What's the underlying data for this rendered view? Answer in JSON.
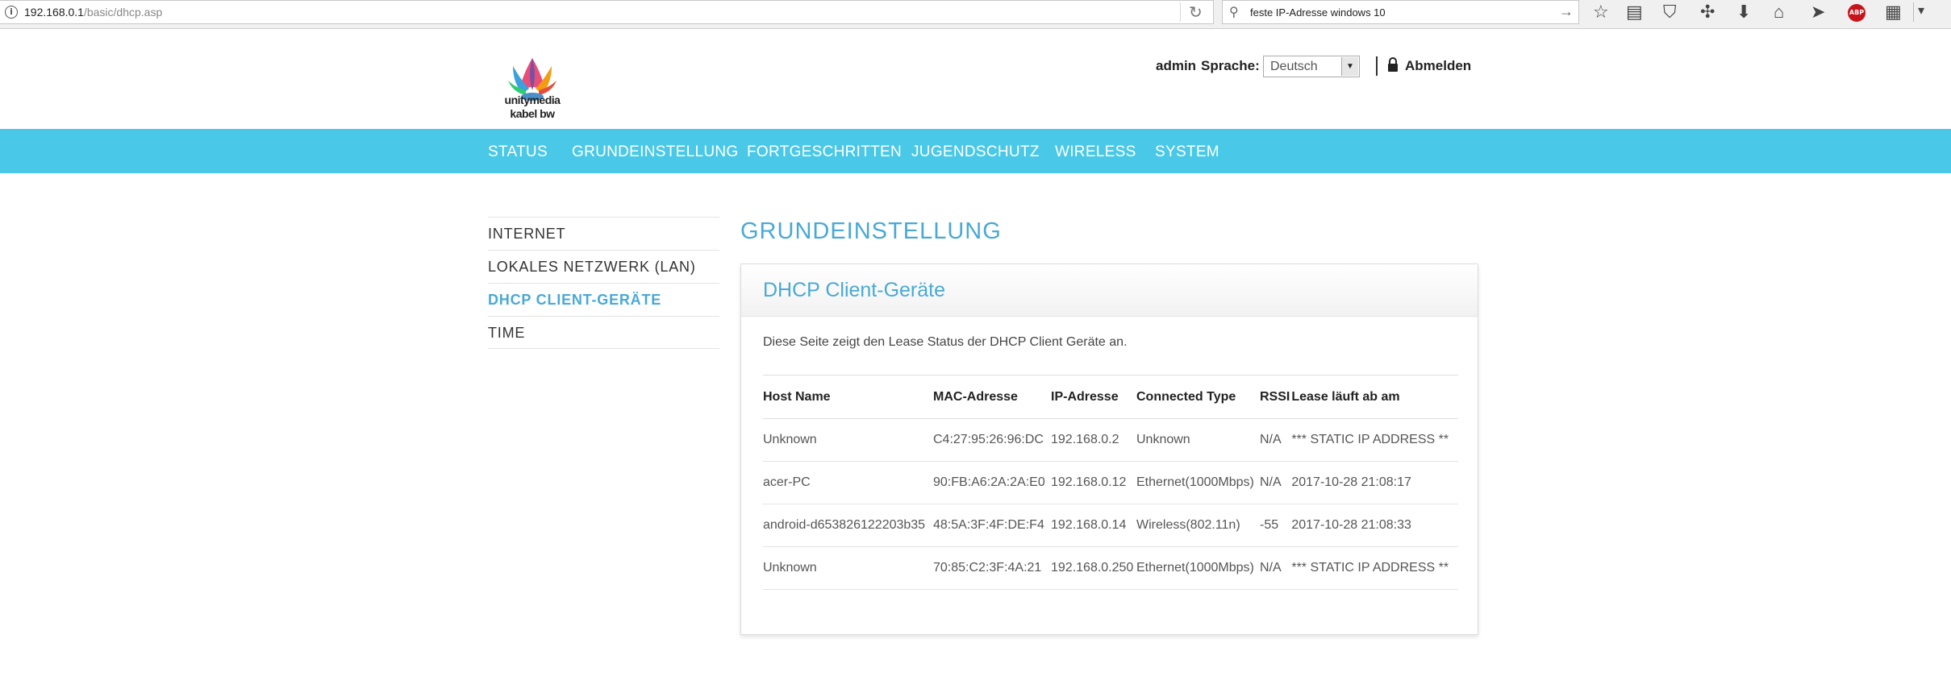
{
  "browser": {
    "url_host": "192.168.0.1",
    "url_path": "/basic/dhcp.asp",
    "search_text": "feste IP-Adresse windows 10",
    "abp_label": "ABP"
  },
  "brand": {
    "line1": "unitymedia",
    "line2": "kabel bw"
  },
  "header": {
    "user": "admin",
    "language_label": "Sprache:",
    "language_value": "Deutsch",
    "logout_label": "Abmelden"
  },
  "nav": {
    "items": [
      "STATUS",
      "GRUNDEINSTELLUNG",
      "FORTGESCHRITTEN",
      "JUGENDSCHUTZ",
      "WIRELESS",
      "SYSTEM"
    ]
  },
  "sidebar": {
    "items": [
      "INTERNET",
      "LOKALES NETZWERK (LAN)",
      "DHCP CLIENT-GERÄTE",
      "TIME"
    ],
    "active": "DHCP CLIENT-GERÄTE"
  },
  "main": {
    "title": "GRUNDEINSTELLUNG",
    "panel_title": "DHCP Client-Geräte",
    "description": "Diese Seite zeigt den Lease Status der DHCP Client Geräte an."
  },
  "table": {
    "headers": [
      "Host Name",
      "MAC-Adresse",
      "IP-Adresse",
      "Connected Type",
      "RSSI",
      "Lease läuft ab am"
    ],
    "rows": [
      [
        "Unknown",
        "C4:27:95:26:96:DC",
        "192.168.0.2",
        "Unknown",
        "N/A",
        "*** STATIC IP ADDRESS **"
      ],
      [
        "acer-PC",
        "90:FB:A6:2A:2A:E0",
        "192.168.0.12",
        "Ethernet(1000Mbps)",
        "N/A",
        "2017-10-28 21:08:17"
      ],
      [
        "android-d653826122203b35",
        "48:5A:3F:4F:DE:F4",
        "192.168.0.14",
        "Wireless(802.11n)",
        "-55",
        "2017-10-28 21:08:33"
      ],
      [
        "Unknown",
        "70:85:C2:3F:4A:21",
        "192.168.0.250",
        "Ethernet(1000Mbps)",
        "N/A",
        "*** STATIC IP ADDRESS **"
      ]
    ]
  },
  "colors": {
    "nav_bg": "#49c8e7",
    "accent": "#49a9d6",
    "abp_red": "#c7141a"
  }
}
